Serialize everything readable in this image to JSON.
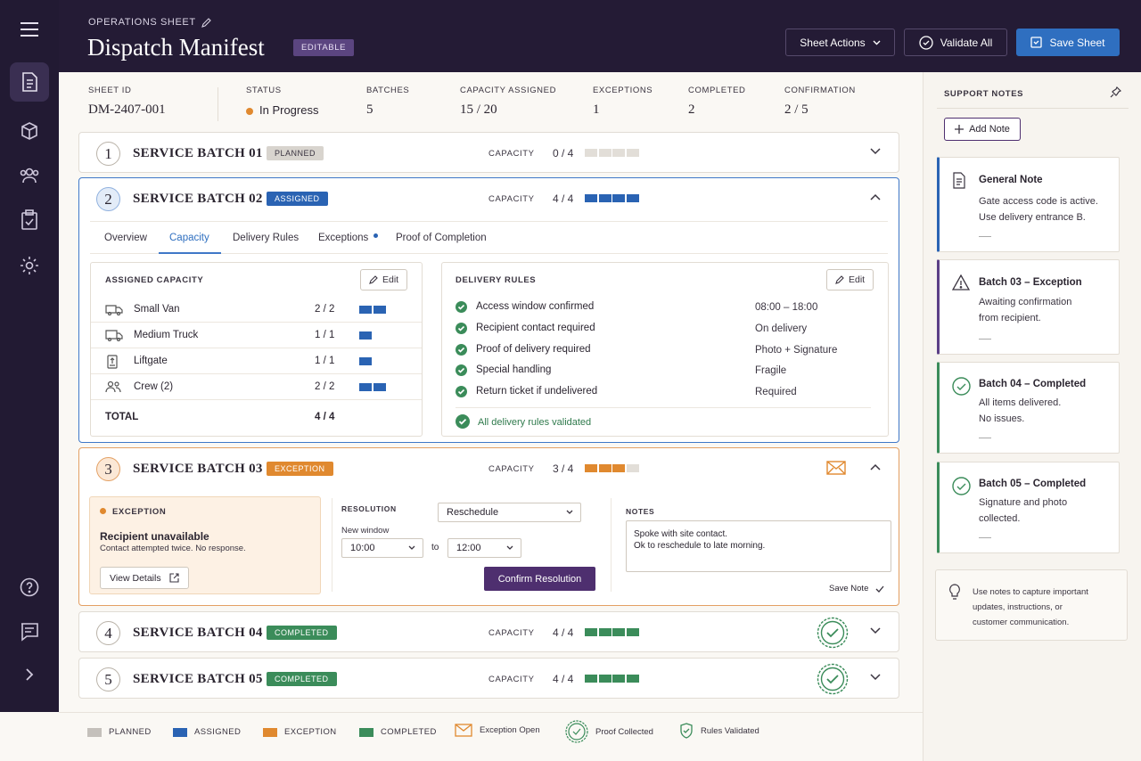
{
  "header": {
    "breadcrumb": "OPERATIONS SHEET",
    "title": "Dispatch Manifest",
    "badge": "EDITABLE",
    "sheet_actions": "Sheet Actions",
    "validate_all": "Validate All",
    "save_sheet": "Save Sheet"
  },
  "summary": {
    "sheet_id": {
      "label": "SHEET ID",
      "value": "DM-2407-001"
    },
    "status": {
      "label": "STATUS",
      "value": "In Progress",
      "color": "#e0892f"
    },
    "batches": {
      "label": "BATCHES",
      "value": "5"
    },
    "capacity": {
      "label": "CAPACITY ASSIGNED",
      "value": "15 / 20"
    },
    "exceptions": {
      "label": "EXCEPTIONS",
      "value": "1"
    },
    "completed": {
      "label": "COMPLETED",
      "value": "2"
    },
    "confirmation": {
      "label": "CONFIRMATION",
      "value": "2 / 5"
    }
  },
  "capacity_label": "CAPACITY",
  "colors": {
    "planned": "#c4c0bb",
    "assigned": "#2a63b3",
    "exception": "#e0892f",
    "completed": "#3b8c5a",
    "empty": "#e2ded8"
  },
  "batches": [
    {
      "num": "1",
      "name": "SERVICE BATCH 01",
      "status": "PLANNED",
      "capacity": "0 / 4",
      "filled": 0
    },
    {
      "num": "2",
      "name": "SERVICE BATCH 02",
      "status": "ASSIGNED",
      "capacity": "4 / 4",
      "filled": 4
    },
    {
      "num": "3",
      "name": "SERVICE BATCH 03",
      "status": "EXCEPTION",
      "capacity": "3 / 4",
      "filled": 3
    },
    {
      "num": "4",
      "name": "SERVICE BATCH 04",
      "status": "COMPLETED",
      "capacity": "4 / 4",
      "filled": 4
    },
    {
      "num": "5",
      "name": "SERVICE BATCH 05",
      "status": "COMPLETED",
      "capacity": "4 / 4",
      "filled": 4
    }
  ],
  "tabs": [
    "Overview",
    "Capacity",
    "Delivery Rules",
    "Exceptions",
    "Proof of Completion"
  ],
  "assigned_capacity": {
    "title": "ASSIGNED CAPACITY",
    "edit": "Edit",
    "rows": [
      {
        "name": "Small Van",
        "value": "2 / 2",
        "filled": 2
      },
      {
        "name": "Medium Truck",
        "value": "1 / 1",
        "filled": 1
      },
      {
        "name": "Liftgate",
        "value": "1 / 1",
        "filled": 1
      },
      {
        "name": "Crew (2)",
        "value": "2 / 2",
        "filled": 2
      }
    ],
    "total_label": "TOTAL",
    "total_value": "4 / 4"
  },
  "delivery_rules": {
    "title": "DELIVERY RULES",
    "edit": "Edit",
    "rules": [
      {
        "name": "Access window confirmed",
        "value": "08:00 – 18:00"
      },
      {
        "name": "Recipient contact required",
        "value": "On delivery"
      },
      {
        "name": "Proof of delivery required",
        "value": "Photo + Signature"
      },
      {
        "name": "Special handling",
        "value": "Fragile"
      },
      {
        "name": "Return ticket if undelivered",
        "value": "Required"
      }
    ],
    "validated": "All delivery rules validated"
  },
  "exception": {
    "label": "EXCEPTION",
    "title": "Recipient unavailable",
    "detail": "Contact attempted twice. No response.",
    "view_details": "View Details",
    "resolution_label": "RESOLUTION",
    "resolution_value": "Reschedule",
    "window_label": "New window",
    "from": "10:00",
    "to_label": "to",
    "to": "12:00",
    "confirm": "Confirm Resolution",
    "notes_label": "NOTES",
    "notes_line1": "Spoke with site contact.",
    "notes_line2": "Ok to reschedule to late morning.",
    "save_note": "Save Note"
  },
  "support": {
    "title": "SUPPORT NOTES",
    "add_note": "Add Note",
    "notes": [
      {
        "title": "General Note",
        "line1": "Gate access code is active.",
        "line2": "Use delivery entrance B.",
        "accent": "#2a63b3"
      },
      {
        "title": "Batch 03 – Exception",
        "line1": "Awaiting confirmation",
        "line2": "from recipient.",
        "accent": "#5b3f86"
      },
      {
        "title": "Batch 04 – Completed",
        "line1": "All items delivered.",
        "line2": "No issues.",
        "accent": "#3b8c5a"
      },
      {
        "title": "Batch 05 – Completed",
        "line1": "Signature and photo",
        "line2": "collected.",
        "accent": "#3b8c5a"
      }
    ],
    "tip_line1": "Use notes to capture important",
    "tip_line2": "updates, instructions, or",
    "tip_line3": "customer communication."
  },
  "legend": [
    "PLANNED",
    "ASSIGNED",
    "EXCEPTION",
    "COMPLETED",
    "Exception Open",
    "Proof Collected",
    "Rules Validated"
  ]
}
